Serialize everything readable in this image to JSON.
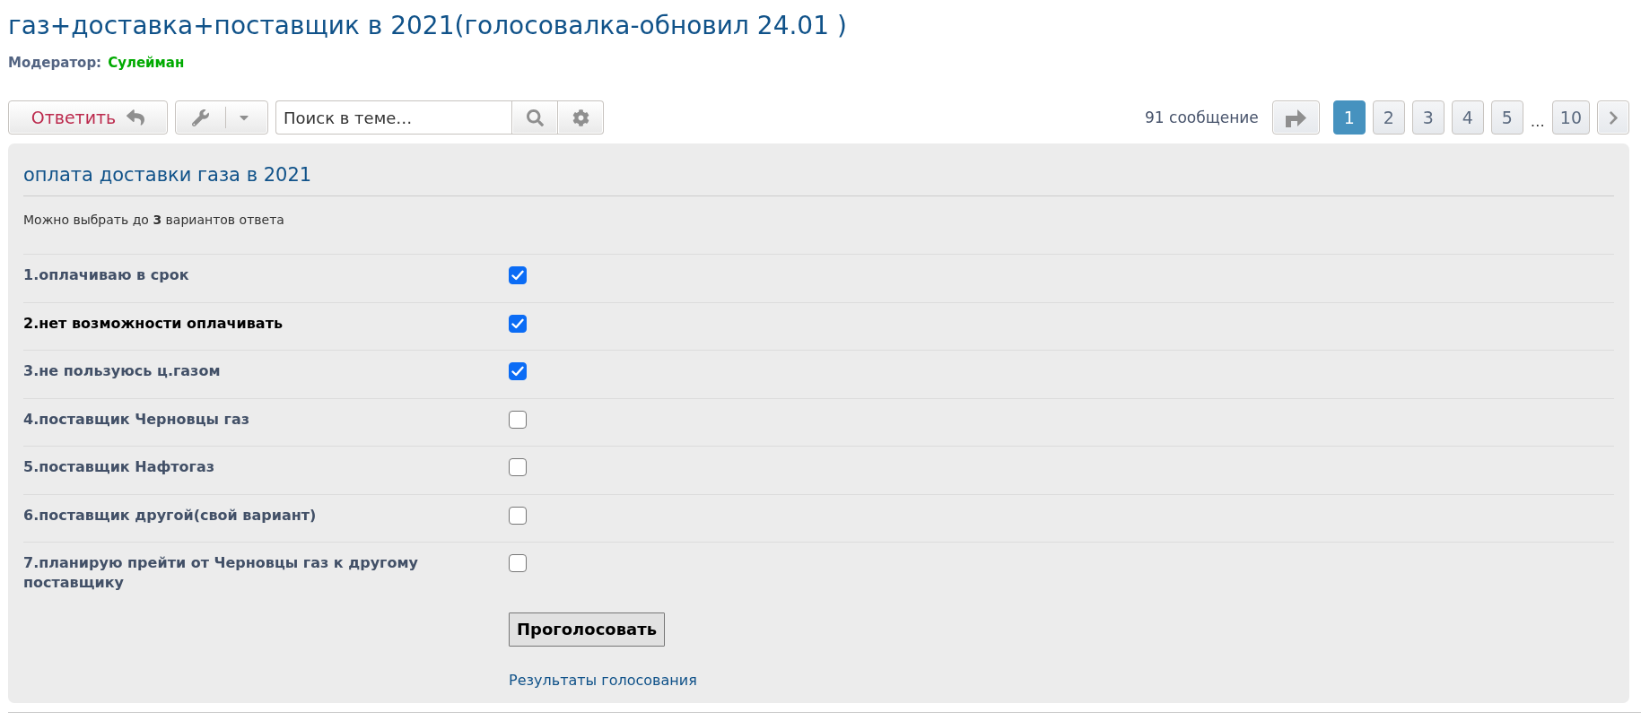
{
  "thread": {
    "title": "газ+доставка+поставщик в 2021(голосовалка-обновил 24.01 )",
    "moderator_label": "Модератор:",
    "moderator_name": "Сулейман"
  },
  "toolbar": {
    "reply_button": "Ответить",
    "search": {
      "placeholder": "Поиск в теме…"
    },
    "post_count": "91 сообщение",
    "pages": [
      {
        "label": "1",
        "selected": true
      },
      {
        "label": "2",
        "selected": false
      },
      {
        "label": "3",
        "selected": false
      },
      {
        "label": "4",
        "selected": false
      },
      {
        "label": "5",
        "selected": false
      }
    ],
    "ellipsis": "…",
    "last_pages": [
      {
        "label": "10",
        "selected": false
      }
    ]
  },
  "poll": {
    "title": "оплата доставки газа в 2021",
    "hint": "Можно выбрать до **3** вариантов ответа",
    "options": [
      {
        "label": "1.оплачиваю в срок",
        "checked": true,
        "hovered": false
      },
      {
        "label": "2.нет возможности оплачивать",
        "checked": true,
        "hovered": true
      },
      {
        "label": "3.не пользуюсь ц.газом",
        "checked": true,
        "hovered": false
      },
      {
        "label": "4.поставщик Черновцы газ",
        "checked": false,
        "hovered": false
      },
      {
        "label": "5.поставщик Нафтогаз",
        "checked": false,
        "hovered": false
      },
      {
        "label": "6.поставщик другой(свой вариант)",
        "checked": false,
        "hovered": false
      },
      {
        "label": "7.планирую прейти от Черновцы газ к другому поставщику",
        "checked": false,
        "hovered": false
      }
    ],
    "vote_button": "Проголосовать",
    "results_link": "Результаты голосования"
  }
}
